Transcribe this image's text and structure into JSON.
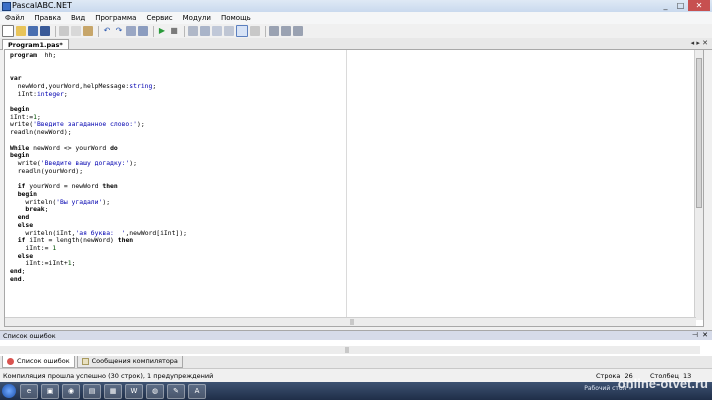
{
  "window": {
    "title": "PascalABC.NET",
    "controls": [
      "_",
      "□",
      "✕"
    ]
  },
  "menu": [
    "Файл",
    "Правка",
    "Вид",
    "Программа",
    "Сервис",
    "Модули",
    "Помощь"
  ],
  "toolbar": {
    "icons": [
      "new-file-icon",
      "open-icon",
      "save-icon",
      "save-all-icon",
      "cut-icon",
      "copy-icon",
      "paste-icon",
      "undo-icon",
      "redo-icon",
      "find-icon",
      "replace-icon",
      "run-icon",
      "stop-icon",
      "compile-icon",
      "debug-icon",
      "step-over-icon",
      "step-into-icon",
      "output-window-icon",
      "form-designer-icon"
    ]
  },
  "tabs": {
    "active_label": "Program1.pas*",
    "nav": "◂ ▸ ✕"
  },
  "editor": {
    "lines": [
      [
        [
          "kw",
          "program"
        ],
        [
          "",
          "  hh;"
        ]
      ],
      [
        [
          "",
          ""
        ]
      ],
      [
        [
          "",
          ""
        ]
      ],
      [
        [
          "kw",
          "var"
        ]
      ],
      [
        [
          "",
          "  newWord,yourWord,helpMessage:"
        ],
        [
          "typ",
          "string"
        ],
        [
          "",
          ";"
        ]
      ],
      [
        [
          "",
          "  iInt:"
        ],
        [
          "typ",
          "integer"
        ],
        [
          "",
          ";"
        ]
      ],
      [
        [
          "",
          ""
        ]
      ],
      [
        [
          "kw",
          "begin"
        ]
      ],
      [
        [
          "",
          "iInt:="
        ],
        [
          "num",
          "1"
        ],
        [
          "",
          ";"
        ]
      ],
      [
        [
          "",
          "write("
        ],
        [
          "str",
          "'Введите загаданное слово:'"
        ],
        [
          "",
          ");"
        ]
      ],
      [
        [
          "",
          "readln(newWord);"
        ]
      ],
      [
        [
          "",
          ""
        ]
      ],
      [
        [
          "kw",
          "While"
        ],
        [
          "",
          " newWord <> yourWord "
        ],
        [
          "kw",
          "do"
        ]
      ],
      [
        [
          "kw",
          "begin"
        ]
      ],
      [
        [
          "",
          "  write("
        ],
        [
          "str",
          "'Введите вашу догадку:'"
        ],
        [
          "",
          ");"
        ]
      ],
      [
        [
          "",
          "  readln(yourWord);"
        ]
      ],
      [
        [
          "",
          ""
        ]
      ],
      [
        [
          "",
          "  "
        ],
        [
          "kw",
          "if"
        ],
        [
          "",
          " yourWord = newWord "
        ],
        [
          "kw",
          "then"
        ]
      ],
      [
        [
          "",
          "  "
        ],
        [
          "kw",
          "begin"
        ]
      ],
      [
        [
          "",
          "    writeln("
        ],
        [
          "str",
          "'Вы угадали'"
        ],
        [
          "",
          ");"
        ]
      ],
      [
        [
          "",
          "    "
        ],
        [
          "kw",
          "break"
        ],
        [
          "",
          ";"
        ]
      ],
      [
        [
          "",
          "  "
        ],
        [
          "kw",
          "end"
        ]
      ],
      [
        [
          "",
          "  "
        ],
        [
          "kw",
          "else"
        ]
      ],
      [
        [
          "",
          "    writeln(iInt,"
        ],
        [
          "str",
          "'ая буква:  '"
        ],
        [
          "",
          ",newWord[iInt]);"
        ]
      ],
      [
        [
          "",
          "  "
        ],
        [
          "kw",
          "if"
        ],
        [
          "",
          " iInt = length(newWord) "
        ],
        [
          "kw",
          "then"
        ]
      ],
      [
        [
          "",
          "    iInt:= "
        ],
        [
          "num",
          "1"
        ]
      ],
      [
        [
          "",
          "  "
        ],
        [
          "kw",
          "else"
        ]
      ],
      [
        [
          "",
          "    iInt:=iInt+"
        ],
        [
          "num",
          "1"
        ],
        [
          "",
          ";"
        ]
      ],
      [
        [
          "kw",
          "end"
        ],
        [
          "",
          ";"
        ]
      ],
      [
        [
          "kw",
          "end"
        ],
        [
          "",
          "."
        ]
      ]
    ]
  },
  "errors_panel": {
    "title": "Список ошибок",
    "pin": "⊣",
    "close": "✕"
  },
  "bottom_tabs": [
    {
      "label": "Список ошибок",
      "active": true
    },
    {
      "label": "Сообщения компилятора",
      "active": false
    }
  ],
  "status": {
    "message": "Компиляция прошла успешно (30 строк), 1 предупреждений",
    "line_label": "Строка",
    "line_value": "26",
    "col_label": "Столбец",
    "col_value": "13"
  },
  "taskbar": {
    "apps": [
      "e",
      "▣",
      "◉",
      "▤",
      "▦",
      "W",
      "◍",
      "✎",
      "A"
    ],
    "tray_text": "Рабочий стол »",
    "watermark": "online-otvet.ru"
  },
  "colors": {
    "keyword": "#000000",
    "string": "#0000b0",
    "number": "#005000",
    "close_button": "#c75050"
  }
}
